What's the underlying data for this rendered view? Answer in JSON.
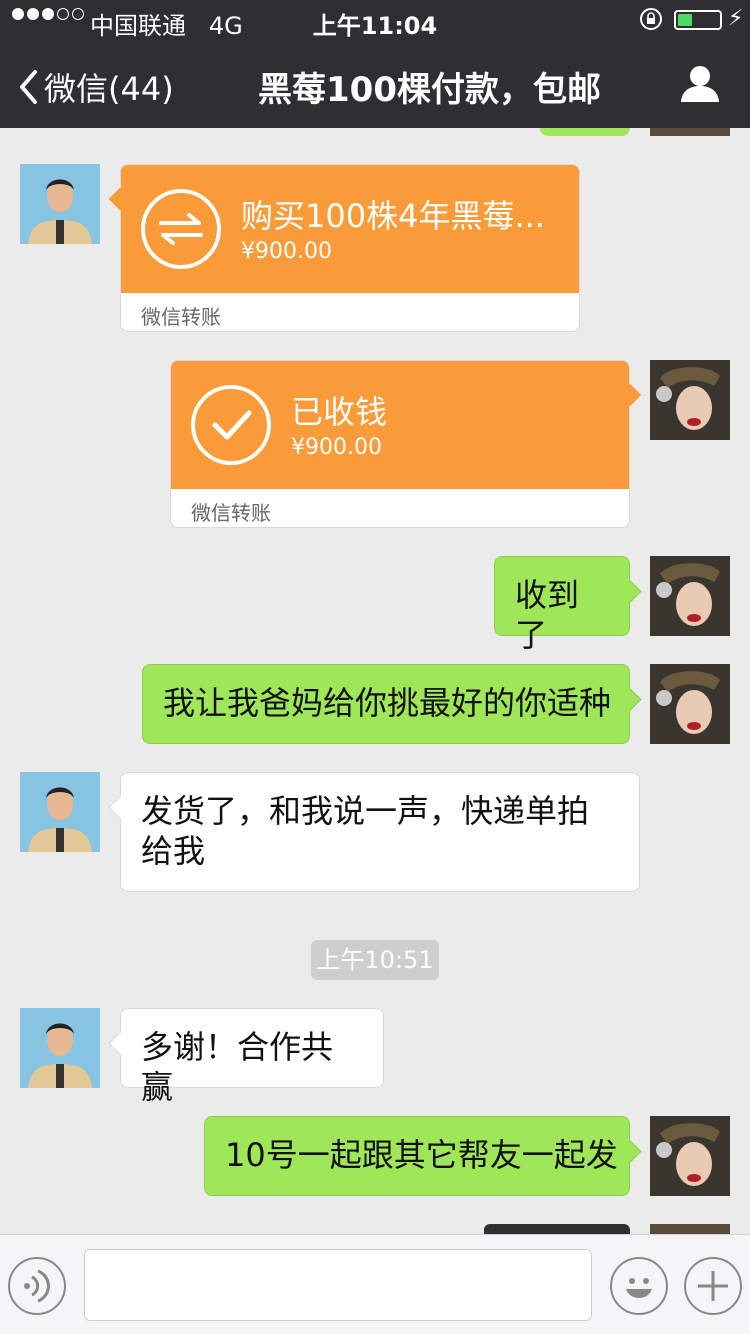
{
  "status_bar": {
    "carrier": "中国联通",
    "network": "4G",
    "time": "上午11:04",
    "signal_bars_filled": 3,
    "signal_bars_total": 5,
    "battery_level": 0.35,
    "battery_color": "#4cd964"
  },
  "nav": {
    "back_label": "微信(44)",
    "title": "黑莓100棵付款，包邮",
    "profile_icon": "person-icon"
  },
  "messages": {
    "transfer_in": {
      "title": "购买100株4年黑莓...",
      "amount": "¥900.00",
      "footer": "微信转账",
      "icon": "transfer-arrows-icon"
    },
    "transfer_received": {
      "title": "已收钱",
      "amount": "¥900.00",
      "footer": "微信转账",
      "icon": "checkmark-icon"
    },
    "m1": "收到了",
    "m2": "我让我爸妈给你挑最好的你适种",
    "m3": "发货了，和我说一声，快递单拍给我",
    "timestamp": "上午10:51",
    "m4": "多谢！合作共赢",
    "m5": "10号一起跟其它帮友一起发"
  },
  "input_bar": {
    "voice_icon": "voice-icon",
    "emoji_icon": "emoji-icon",
    "plus_icon": "plus-icon",
    "field_value": ""
  },
  "colors": {
    "header_bg": "#2e2e33",
    "chat_bg": "#ebebeb",
    "green_bubble": "#9fe658",
    "transfer_orange": "#f99b38"
  }
}
